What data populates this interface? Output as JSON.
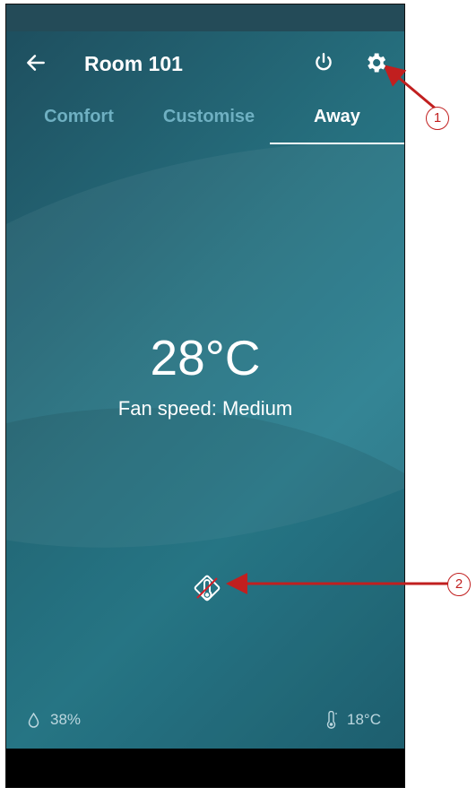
{
  "header": {
    "title": "Room 101"
  },
  "tabs": [
    {
      "label": "Comfort",
      "active": false
    },
    {
      "label": "Customise",
      "active": false
    },
    {
      "label": "Away",
      "active": true
    }
  ],
  "main": {
    "temperature": "28°C",
    "fan_speed": "Fan speed: Medium"
  },
  "footer": {
    "humidity": "38%",
    "ambient_temperature": "18°C"
  },
  "icons": {
    "back": "arrow-left-icon",
    "power": "power-icon",
    "settings": "gear-icon",
    "mode": "thermometer-off-icon",
    "humidity": "droplet-icon",
    "ambient": "thermometer-icon"
  },
  "annotations": {
    "callout_1": "1",
    "callout_2": "2",
    "color": "#c11f1f"
  },
  "colors": {
    "accent_tab_inactive": "#6fb0c2",
    "text": "#ffffff"
  }
}
